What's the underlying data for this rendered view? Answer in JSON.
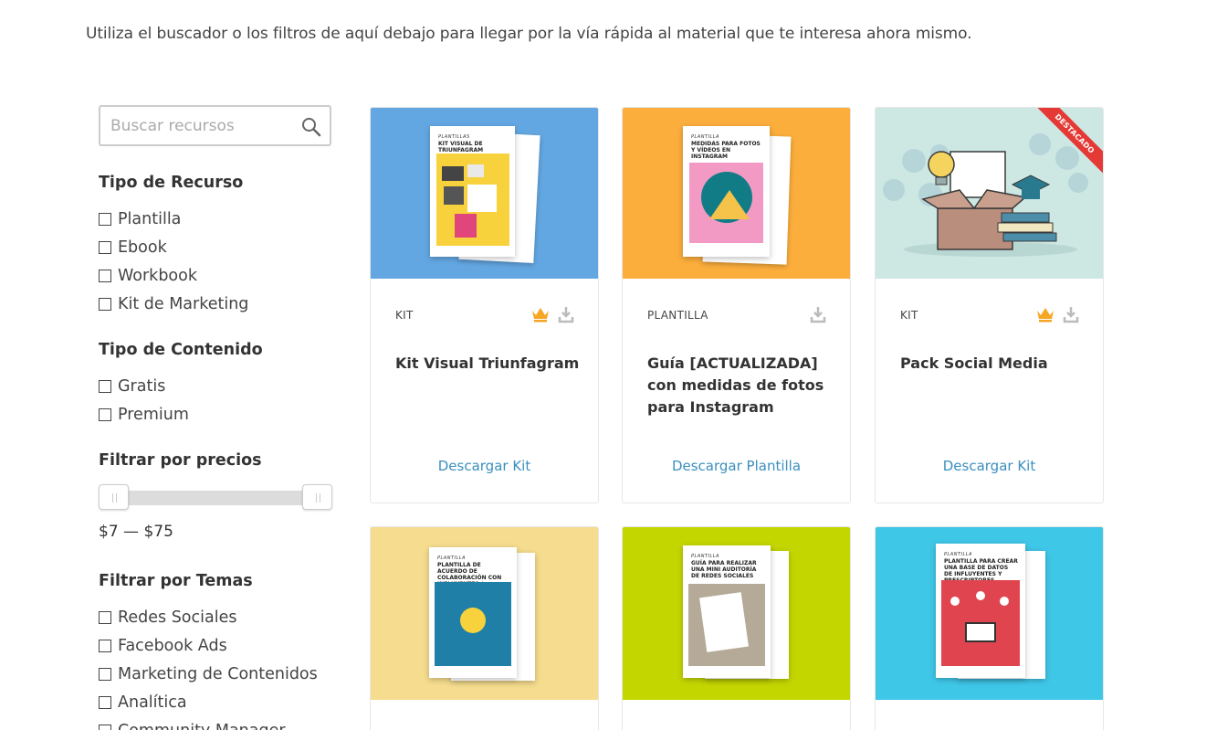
{
  "intro": "Utiliza el buscador o los filtros de aquí debajo para llegar por la vía rápida al material que te interesa ahora mismo.",
  "search": {
    "placeholder": "Buscar recursos"
  },
  "filters": {
    "tipo_recurso": {
      "title": "Tipo de Recurso",
      "options": [
        "Plantilla",
        "Ebook",
        "Workbook",
        "Kit de Marketing"
      ]
    },
    "tipo_contenido": {
      "title": "Tipo de Contenido",
      "options": [
        "Gratis",
        "Premium"
      ]
    },
    "precio": {
      "title": "Filtrar por precios",
      "label": "$7 — $75",
      "min": 7,
      "max": 75
    },
    "temas": {
      "title": "Filtrar por Temas",
      "options": [
        "Redes Sociales",
        "Facebook Ads",
        "Marketing de Contenidos",
        "Analítica",
        "Community Manager"
      ]
    }
  },
  "cards": [
    {
      "type": "KIT",
      "title": "Kit Visual Triunfagram",
      "cta": "Descargar Kit",
      "premium": true,
      "bg": "#63a7e2",
      "doc_tag": "PLANTILLAS",
      "doc_title": "KIT VISUAL DE TRIUNFAGRAM",
      "accent": "#f7d23c"
    },
    {
      "type": "PLANTILLA",
      "title": "Guía [ACTUALIZADA] con medidas de fotos para Instagram",
      "cta": "Descargar Plantilla",
      "premium": false,
      "bg": "#fbae3c",
      "doc_tag": "PLANTILLA",
      "doc_title": "MEDIDAS PARA FOTOS Y VÍDEOS EN INSTAGRAM",
      "accent": "#f29ac4"
    },
    {
      "type": "KIT",
      "title": "Pack Social Media",
      "cta": "Descargar Kit",
      "premium": true,
      "bg": "#cde7e3",
      "ribbon": "DESTACADO"
    },
    {
      "bg": "#f5dc8e",
      "doc_tag": "PLANTILLA",
      "doc_title": "PLANTILLA DE ACUERDO DE COLABORACIÓN CON INFLUYENTES / PRESCRIPTORES",
      "accent": "#1f7fa6"
    },
    {
      "bg": "#c4d600",
      "doc_tag": "PLANTILLA",
      "doc_title": "GUÍA PARA REALIZAR UNA MINI AUDITORÍA DE REDES SOCIALES",
      "accent": "#b5aa98"
    },
    {
      "bg": "#3fc7e8",
      "doc_tag": "PLANTILLA",
      "doc_title": "PLANTILLA PARA CREAR UNA BASE DE DATOS DE INFLUYENTES Y PRESCRIPTORES",
      "accent": "#e0454f"
    }
  ],
  "colors": {
    "link": "#3a8fbe",
    "crown": "#f5a623",
    "download": "#bbbbbb"
  }
}
